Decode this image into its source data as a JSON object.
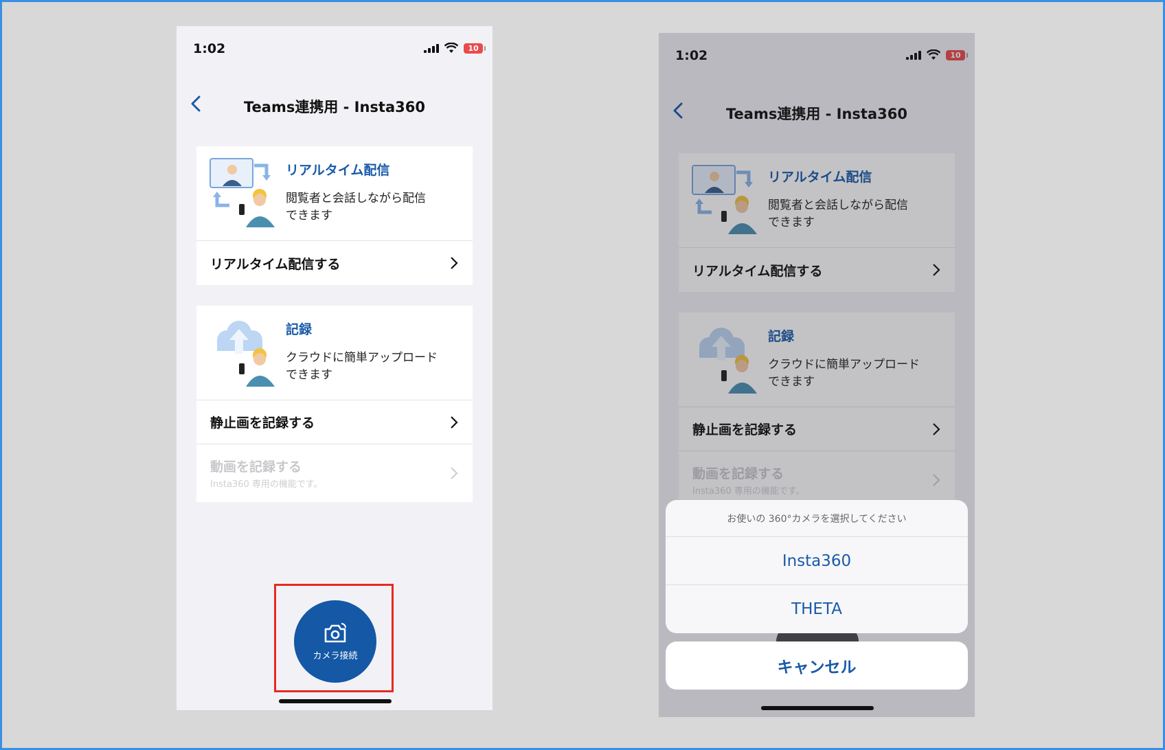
{
  "status": {
    "time": "1:02",
    "battery": "10"
  },
  "nav": {
    "title": "Teams連携用 - Insta360"
  },
  "cards": {
    "realtime": {
      "title": "リアルタイム配信",
      "desc_line1": "閲覧者と会話しながら配信",
      "desc_line2": "できます",
      "action": "リアルタイム配信する"
    },
    "record": {
      "title": "記録",
      "desc_line1": "クラウドに簡単アップロード",
      "desc_line2": "できます",
      "action_photo": "静止画を記録する",
      "action_video": "動画を記録する",
      "action_video_sub": "Insta360 専用の機能です。"
    }
  },
  "fab": {
    "label": "カメラ接続"
  },
  "action_sheet": {
    "header": "お使いの 360°カメラを選択してください",
    "options": [
      "Insta360",
      "THETA"
    ],
    "cancel": "キャンセル"
  },
  "colors": {
    "accent": "#1458a6",
    "highlight": "#e62a22"
  }
}
